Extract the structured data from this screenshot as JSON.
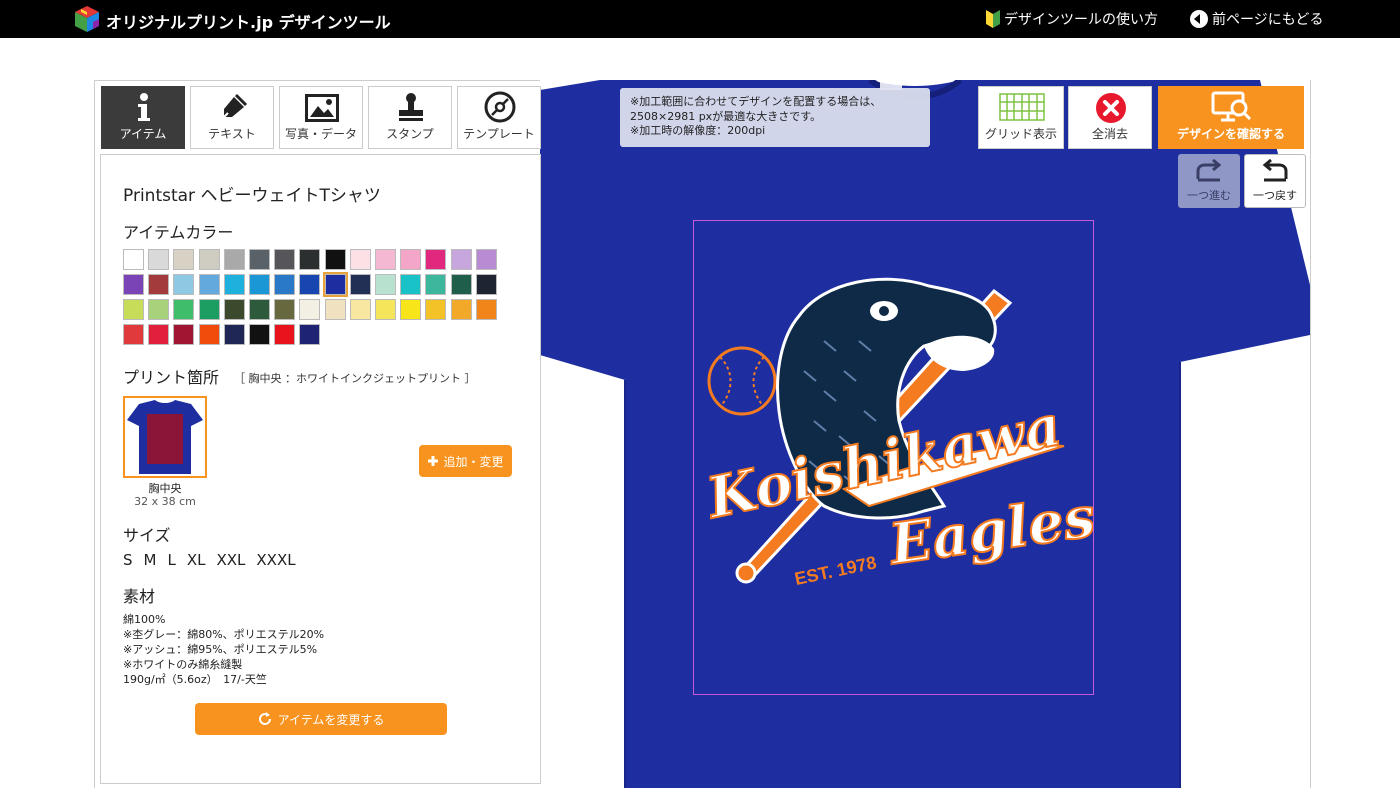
{
  "header": {
    "logo_text": "オリジナルプリント.jp デザインツール",
    "howto_label": "デザインツールの使い方",
    "back_label": "前ページにもどる"
  },
  "tabs": [
    {
      "label": "アイテム",
      "icon": "info-icon",
      "active": true
    },
    {
      "label": "テキスト",
      "icon": "pen-icon",
      "active": false
    },
    {
      "label": "写真・データ",
      "icon": "image-icon",
      "active": false
    },
    {
      "label": "スタンプ",
      "icon": "stamp-icon",
      "active": false
    },
    {
      "label": "テンプレート",
      "icon": "template-icon",
      "active": false
    }
  ],
  "tools": {
    "grid_label": "グリッド表示",
    "clear_label": "全消去",
    "confirm_label": "デザインを確認する",
    "redo_label": "一つ進む",
    "undo_label": "一つ戻す"
  },
  "canvas": {
    "info_lines": [
      "※加工範囲に合わせてデザインを配置する場合は、",
      "2508×2981 pxが最適な大きさです。",
      "※加工時の解像度：200dpi"
    ],
    "design_text_1": "Koishikawa",
    "design_text_2": "Eagles",
    "design_text_3": "EST. 1978",
    "shirt_color": "#1e2ea0"
  },
  "panel": {
    "product_name": "Printstar ヘビーウェイトTシャツ",
    "color_title": "アイテムカラー",
    "colors": [
      "#ffffff",
      "#d9d9d9",
      "#d8d2c4",
      "#cfcdc2",
      "#a9a9a9",
      "#5a6269",
      "#55555a",
      "#2c2f30",
      "#111111",
      "#fbe0e6",
      "#f5b8d2",
      "#f4a6c9",
      "#e0287f",
      "#c6a6dc",
      "#b98bd2",
      "#7a43b6",
      "#a33a3c",
      "#8ec9e3",
      "#63a9dd",
      "#1fb1dd",
      "#1a97d4",
      "#2a78c8",
      "#1746b0",
      "#1e2ea0",
      "#233055",
      "#b8e2cf",
      "#19c2c7",
      "#3cb79d",
      "#1f5e4a",
      "#1e2432",
      "#c7dd5a",
      "#a7d27b",
      "#3fbd6b",
      "#1c9d61",
      "#3b4a2c",
      "#2e5a3c",
      "#68683e",
      "#f3efe2",
      "#f0e2c0",
      "#f7e7a0",
      "#f5e55a",
      "#f7e51a",
      "#f2c227",
      "#f2a92a",
      "#f28519",
      "#e03a3c",
      "#e0203c",
      "#a11533",
      "#f24c0c",
      "#1f2756",
      "#111111",
      "#e8131b",
      "#1e2373"
    ],
    "selected_color_index": 23,
    "print_title": "プリント箇所",
    "print_sub": "［ 胸中央 ：ホワイトインクジェットプリント ］",
    "print_location": "胸中央",
    "print_size": "32 x 38 cm",
    "add_label": "追加・変更",
    "size_title": "サイズ",
    "sizes": [
      "S",
      "M",
      "L",
      "XL",
      "XXL",
      "XXXL"
    ],
    "material_title": "素材",
    "material_lines": [
      "綿100%",
      "※杢グレー：綿80%、ポリエステル20%",
      "※アッシュ：綿95%、ポリエステル5%",
      "※ホワイトのみ綿糸縫製",
      "190g/㎡（5.6oz）　17/-天竺"
    ],
    "change_label": "アイテムを変更する"
  }
}
